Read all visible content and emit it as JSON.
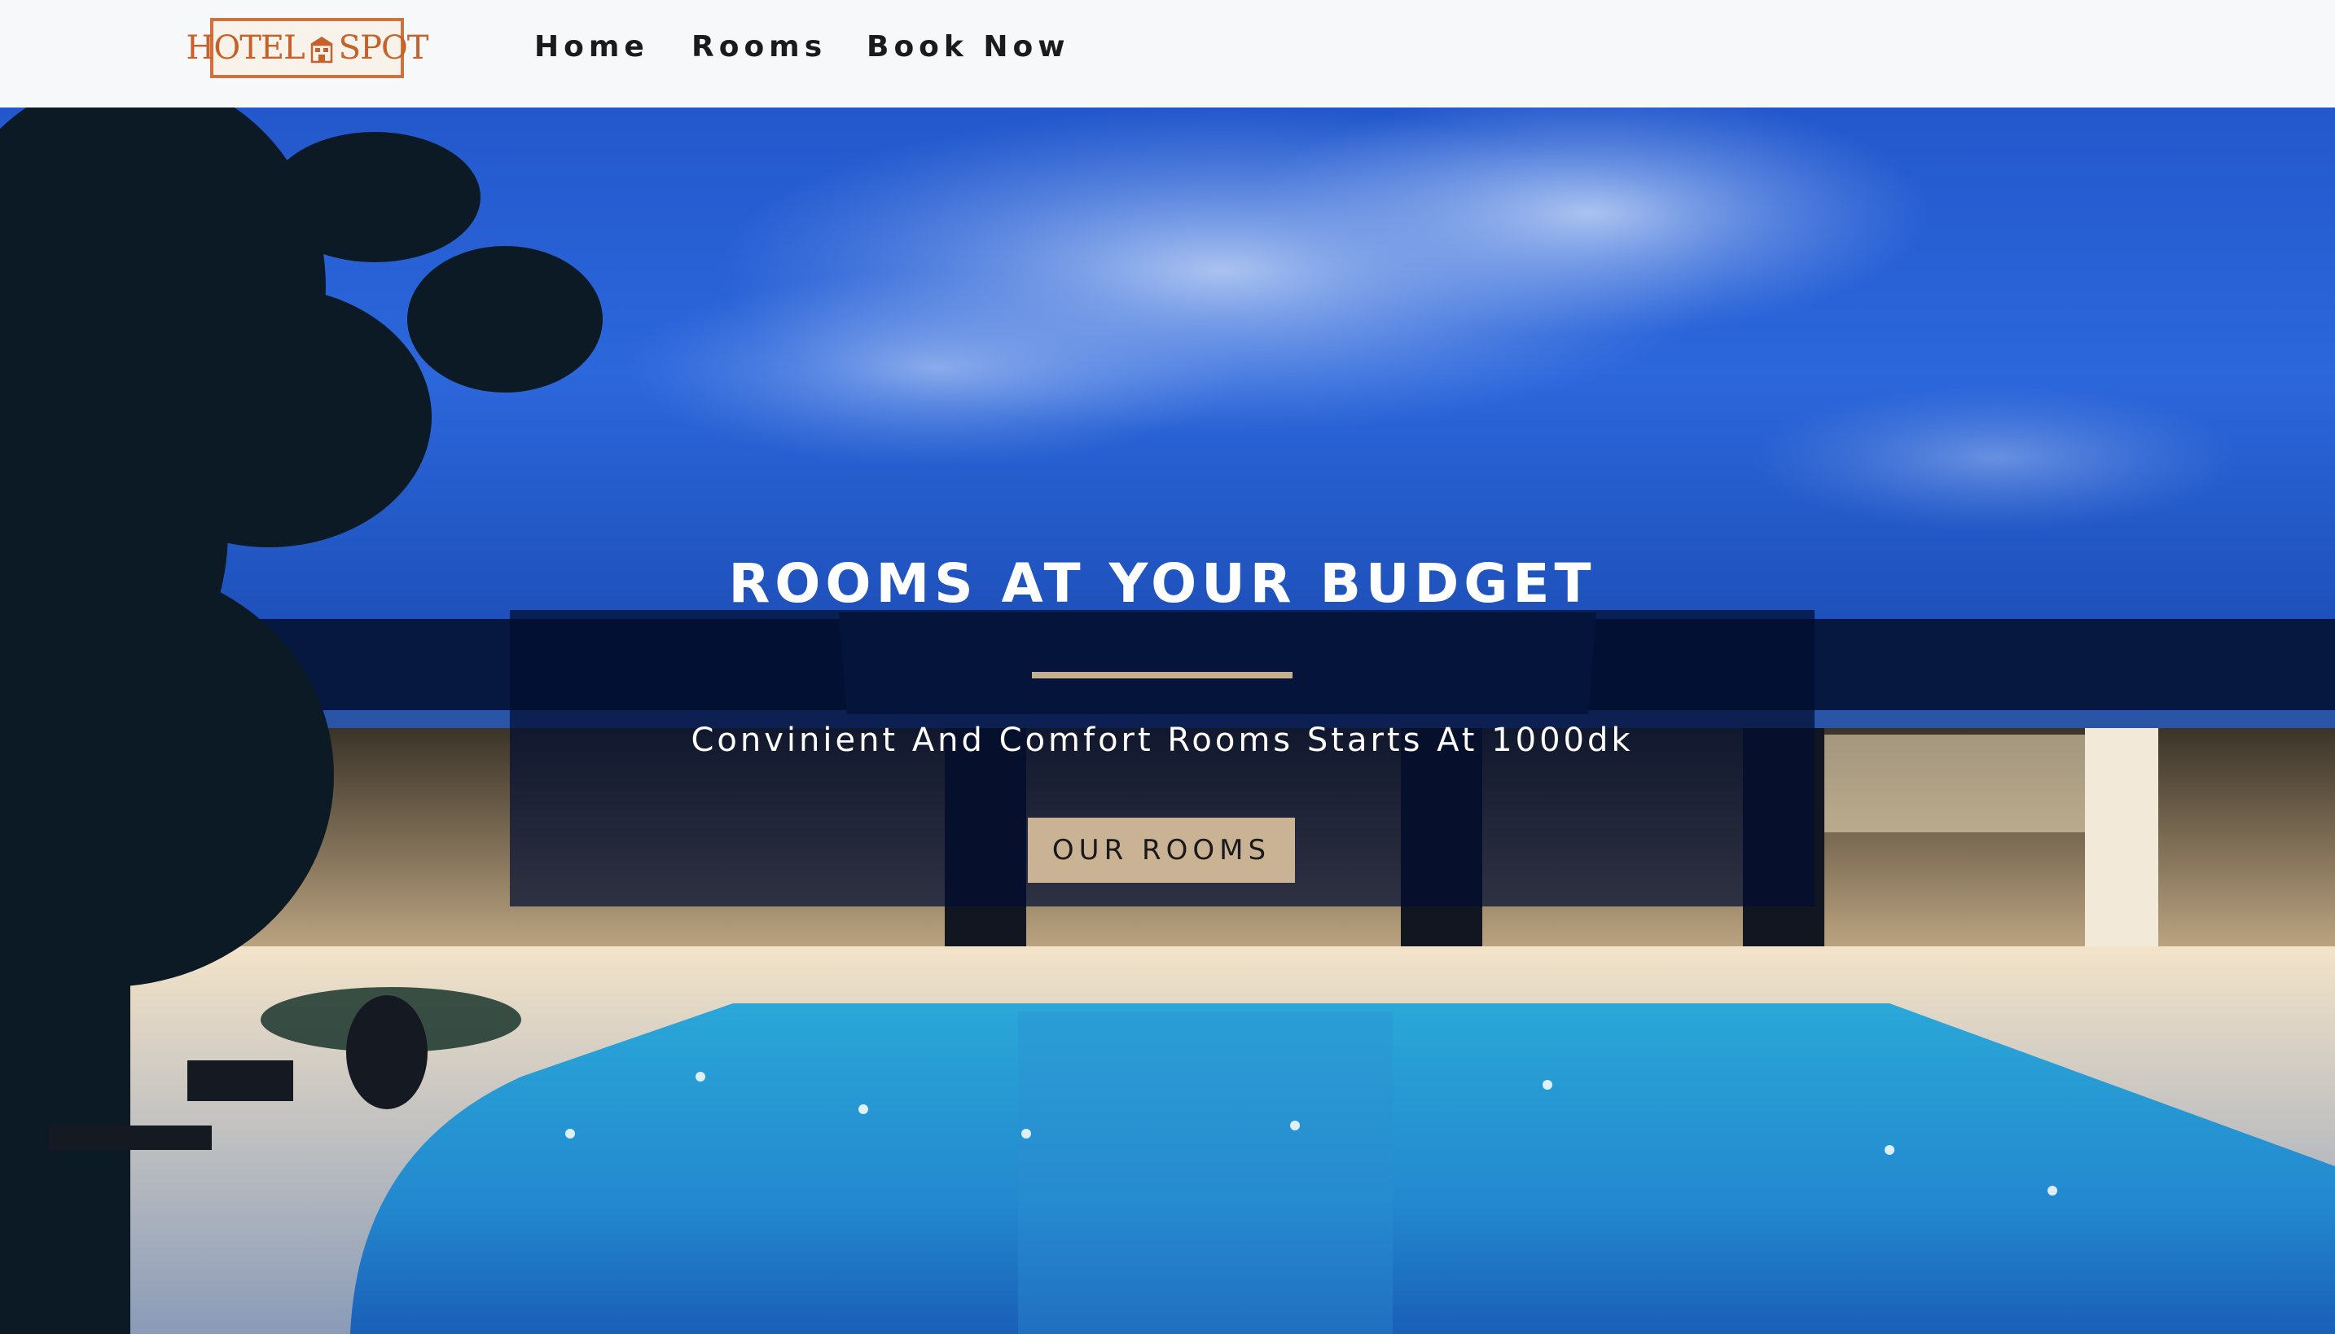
{
  "header": {
    "logo_text": "HOTEL SPOT",
    "nav": [
      {
        "label": "Home"
      },
      {
        "label": "Rooms"
      },
      {
        "label": "Book Now"
      }
    ]
  },
  "hero": {
    "title": "ROOMS AT YOUR BUDGET",
    "subtitle": "Convinient And Comfort Rooms Starts At 1000dk",
    "cta_label": "OUR ROOMS",
    "background_image": "hotel-pool-at-dusk"
  },
  "colors": {
    "navbar_bg": "#f7f8f9",
    "logo_accent": "#d2703a",
    "overlay": "rgba(2,14,48,0.72)",
    "divider": "#c8b08c",
    "cta_bg": "#c9b394",
    "sky": "#2f66d6"
  }
}
